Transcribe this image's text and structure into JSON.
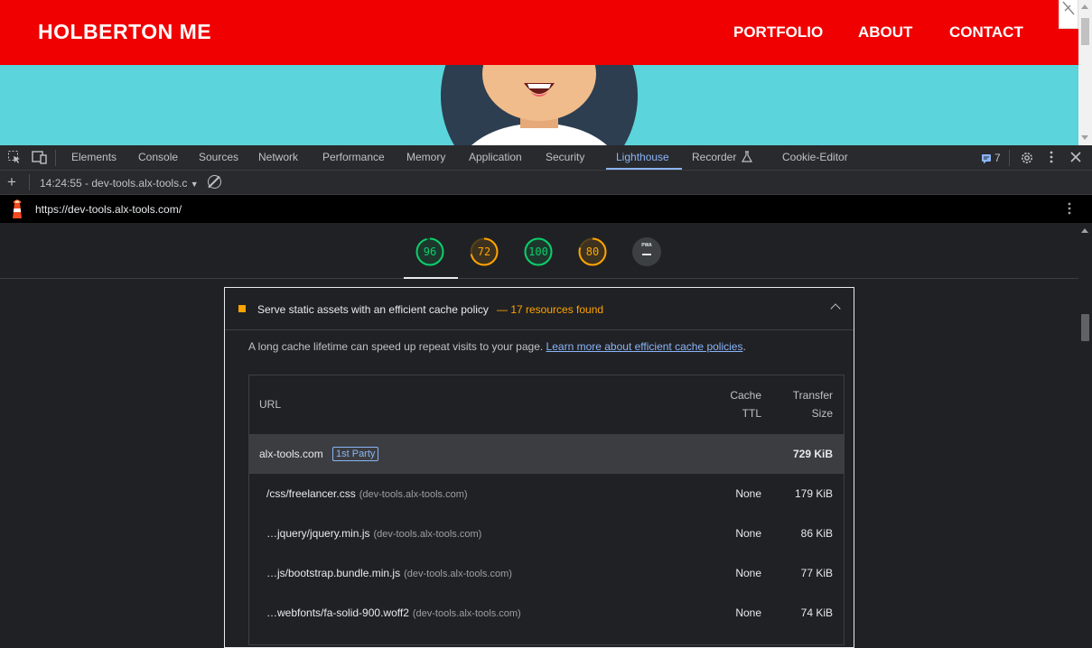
{
  "site": {
    "brand": "HOLBERTON ME",
    "nav": [
      "PORTFOLIO",
      "ABOUT",
      "CONTACT"
    ],
    "colors": {
      "nav": "#f00000",
      "hero": "#5bd5db"
    }
  },
  "devtools": {
    "tabs": [
      "Elements",
      "Console",
      "Sources",
      "Network",
      "Performance",
      "Memory",
      "Application",
      "Security",
      "Lighthouse",
      "Recorder",
      "Cookie-Editor"
    ],
    "active_tab": "Lighthouse",
    "issues_count": "7"
  },
  "lighthouse": {
    "report_select": "14:24:55 - dev-tools.alx-tools.c",
    "url": "https://dev-tools.alx-tools.com/",
    "scores": [
      {
        "value": "96",
        "color": "#0cce6b",
        "fraction": 0.96
      },
      {
        "value": "72",
        "color": "#ffa400",
        "fraction": 0.72
      },
      {
        "value": "100",
        "color": "#0cce6b",
        "fraction": 1.0
      },
      {
        "value": "80",
        "color": "#ffa400",
        "fraction": 0.8
      }
    ],
    "pwa_label": "PWA"
  },
  "audit": {
    "title": "Serve static assets with an efficient cache policy",
    "display_value": "— 17 resources found",
    "description": "A long cache lifetime can speed up repeat visits to your page.",
    "learn_more": "Learn more about efficient cache policies",
    "headers": {
      "url": "URL",
      "ttl_1": "Cache",
      "ttl_2": "TTL",
      "size_1": "Transfer",
      "size_2": "Size"
    },
    "group": {
      "name": "alx-tools.com",
      "badge": "1st Party",
      "size": "729 KiB"
    },
    "rows": [
      {
        "path": "/css/freelancer.css",
        "host": "(dev-tools.alx-tools.com)",
        "ttl": "None",
        "size": "179 KiB"
      },
      {
        "path": "…jquery/jquery.min.js",
        "host": "(dev-tools.alx-tools.com)",
        "ttl": "None",
        "size": "86 KiB"
      },
      {
        "path": "…js/bootstrap.bundle.min.js",
        "host": "(dev-tools.alx-tools.com)",
        "ttl": "None",
        "size": "77 KiB"
      },
      {
        "path": "…webfonts/fa-solid-900.woff2",
        "host": "(dev-tools.alx-tools.com)",
        "ttl": "None",
        "size": "74 KiB"
      }
    ]
  }
}
